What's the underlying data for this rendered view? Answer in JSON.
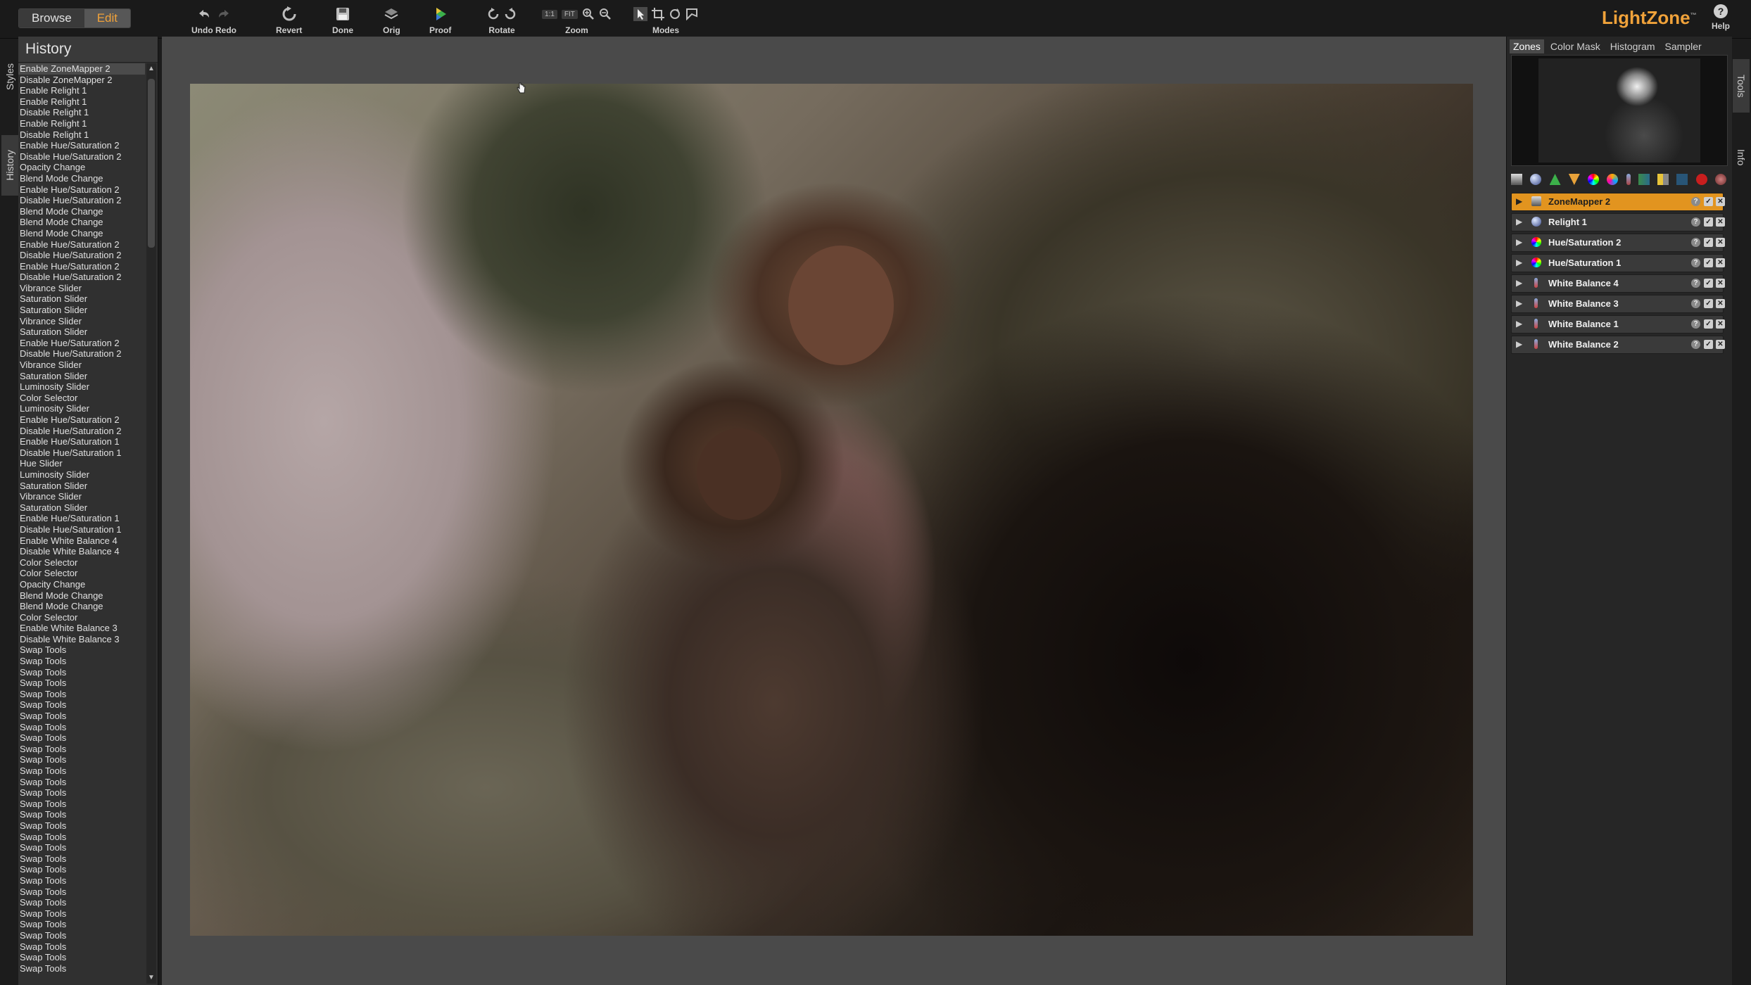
{
  "app": {
    "name": "LightZone"
  },
  "mode": {
    "browse": "Browse",
    "edit": "Edit"
  },
  "toolbar": {
    "undo_redo": "Undo Redo",
    "revert": "Revert",
    "done": "Done",
    "orig": "Orig",
    "proof": "Proof",
    "rotate": "Rotate",
    "zoom": "Zoom",
    "zoom_one": "1:1",
    "zoom_fit": "FIT",
    "modes": "Modes",
    "help": "Help"
  },
  "left_tabs": {
    "styles": "Styles",
    "history": "History"
  },
  "right_tabs": {
    "tools": "Tools",
    "info": "Info"
  },
  "history": {
    "title": "History",
    "items": [
      "Enable ZoneMapper 2",
      "Disable ZoneMapper 2",
      "Enable Relight 1",
      "Enable Relight 1",
      "Disable Relight 1",
      "Enable Relight 1",
      "Disable Relight 1",
      "Enable Hue/Saturation 2",
      "Disable Hue/Saturation 2",
      "Opacity Change",
      "Blend Mode Change",
      "Enable Hue/Saturation 2",
      "Disable Hue/Saturation 2",
      "Blend Mode Change",
      "Blend Mode Change",
      "Blend Mode Change",
      "Enable Hue/Saturation 2",
      "Disable Hue/Saturation 2",
      "Enable Hue/Saturation 2",
      "Disable Hue/Saturation 2",
      "Vibrance Slider",
      "Saturation Slider",
      "Saturation Slider",
      "Vibrance Slider",
      "Saturation Slider",
      "Enable Hue/Saturation 2",
      "Disable Hue/Saturation 2",
      "Vibrance Slider",
      "Saturation Slider",
      "Luminosity Slider",
      "Color Selector",
      "Luminosity Slider",
      "Enable Hue/Saturation 2",
      "Disable Hue/Saturation 2",
      "Enable Hue/Saturation 1",
      "Disable Hue/Saturation 1",
      "Hue Slider",
      "Luminosity Slider",
      "Saturation Slider",
      "Vibrance Slider",
      "Saturation Slider",
      "Enable Hue/Saturation 1",
      "Disable Hue/Saturation 1",
      "Enable White Balance 4",
      "Disable White Balance 4",
      "Color Selector",
      "Color Selector",
      "Opacity Change",
      "Blend Mode Change",
      "Blend Mode Change",
      "Color Selector",
      "Enable White Balance 3",
      "Disable White Balance 3",
      "Swap Tools",
      "Swap Tools",
      "Swap Tools",
      "Swap Tools",
      "Swap Tools",
      "Swap Tools",
      "Swap Tools",
      "Swap Tools",
      "Swap Tools",
      "Swap Tools",
      "Swap Tools",
      "Swap Tools",
      "Swap Tools",
      "Swap Tools",
      "Swap Tools",
      "Swap Tools",
      "Swap Tools",
      "Swap Tools",
      "Swap Tools",
      "Swap Tools",
      "Swap Tools",
      "Swap Tools",
      "Swap Tools",
      "Swap Tools",
      "Swap Tools",
      "Swap Tools",
      "Swap Tools",
      "Swap Tools",
      "Swap Tools",
      "Swap Tools"
    ]
  },
  "tools_panel": {
    "tabs": [
      "Zones",
      "Color Mask",
      "Histogram",
      "Sampler"
    ],
    "active_tab": "Zones",
    "tool_stack": [
      {
        "name": "ZoneMapper 2",
        "icon": "zonemapper-icon",
        "active": true
      },
      {
        "name": "Relight 1",
        "icon": "relight-icon",
        "active": false
      },
      {
        "name": "Hue/Saturation 2",
        "icon": "hue-saturation-icon",
        "active": false
      },
      {
        "name": "Hue/Saturation 1",
        "icon": "hue-saturation-icon",
        "active": false
      },
      {
        "name": "White Balance 4",
        "icon": "white-balance-icon",
        "active": false
      },
      {
        "name": "White Balance 3",
        "icon": "white-balance-icon",
        "active": false
      },
      {
        "name": "White Balance 1",
        "icon": "white-balance-icon",
        "active": false
      },
      {
        "name": "White Balance 2",
        "icon": "white-balance-icon",
        "active": false
      }
    ]
  },
  "colors": {
    "accent": "#f0a23a",
    "active_tool": "#e2941f",
    "panel_bg": "#262626",
    "canvas_bg": "#4a4a4a"
  }
}
